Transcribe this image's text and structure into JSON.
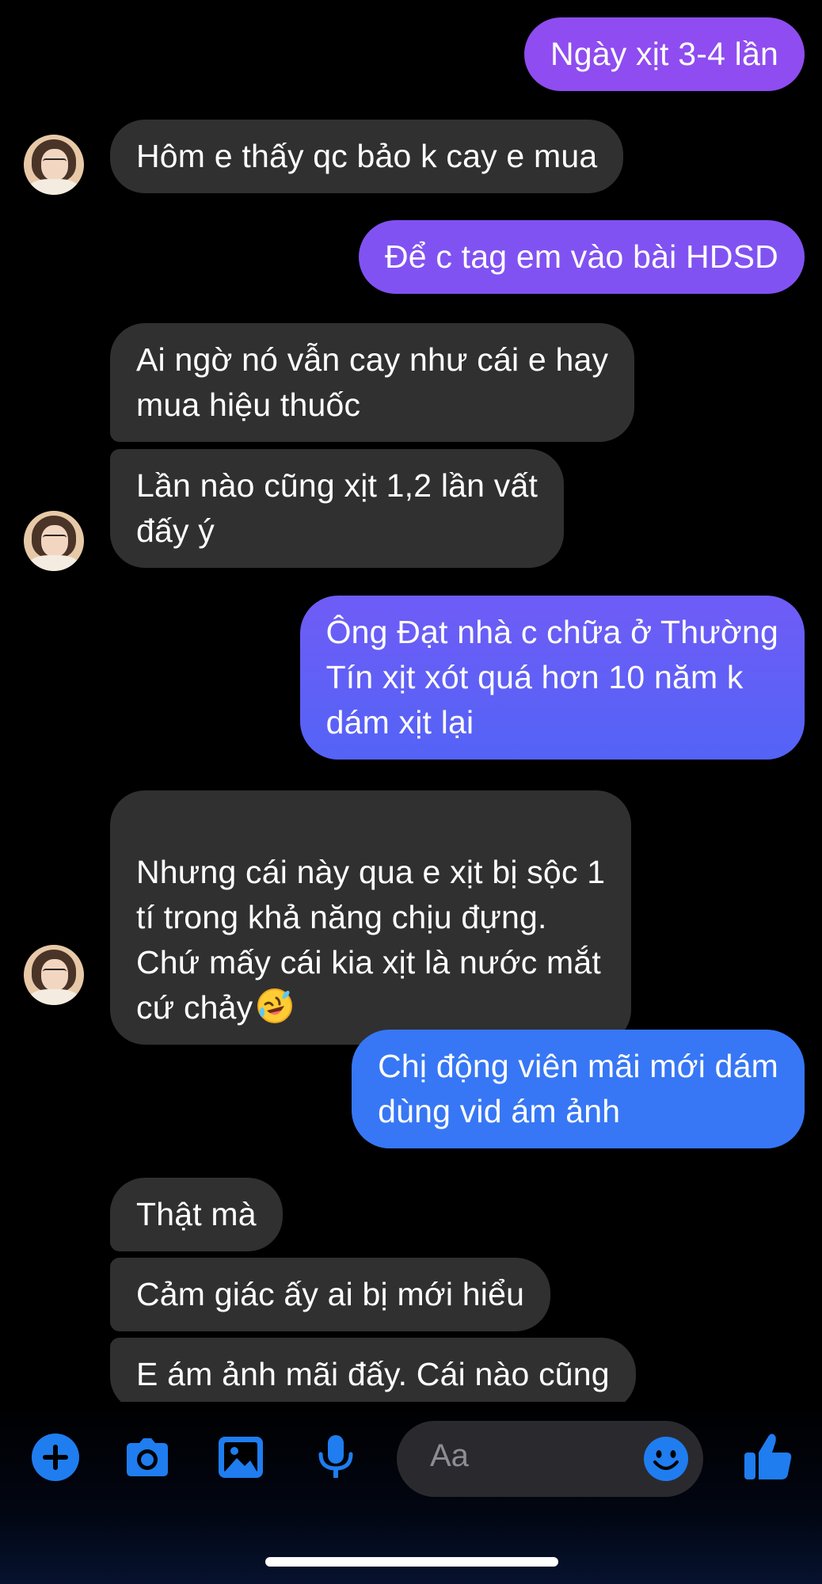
{
  "conversation": {
    "messages": [
      {
        "side": "out",
        "text": "Ngày xịt 3-4 lần"
      },
      {
        "side": "in",
        "text": "Hôm e thấy qc bảo k cay e mua"
      },
      {
        "side": "out",
        "text": "Để c tag em vào bài HDSD"
      },
      {
        "side": "in",
        "text": "Ai ngờ nó vẫn cay như cái e hay\nmua hiệu thuốc"
      },
      {
        "side": "in",
        "text": "Lần nào cũng xịt 1,2 lần vất\nđấy ý"
      },
      {
        "side": "out",
        "text": "Ông Đạt nhà c chữa ở Thường\nTín xịt xót quá hơn 10 năm k\ndám xịt lại"
      },
      {
        "side": "in",
        "text": "Nhưng cái này qua e xịt bị sộc 1\ntí trong khả năng chịu đựng.\nChứ mấy cái kia xịt là nước mắt\ncứ chảy",
        "emoji": "rolling-on-floor-laughing-emoji"
      },
      {
        "side": "out",
        "text": "Chị động viên mãi mới dám\ndùng vid ám ảnh"
      },
      {
        "side": "in",
        "text": "Thật mà"
      },
      {
        "side": "in",
        "text": "Cảm giác ấy ai bị mới hiểu"
      },
      {
        "side": "in",
        "text": "E ám ảnh mãi đấy. Cái nào cũng"
      }
    ]
  },
  "composer": {
    "placeholder": "Aa",
    "icons": [
      "plus-icon",
      "camera-icon",
      "photo-icon",
      "microphone-icon",
      "emoji-icon",
      "thumbs-up-icon"
    ]
  },
  "colors": {
    "outgoing_top": "#8a4ff2",
    "outgoing_bottom": "#3a75f5",
    "incoming": "#303030",
    "accent": "#1f7df0"
  }
}
